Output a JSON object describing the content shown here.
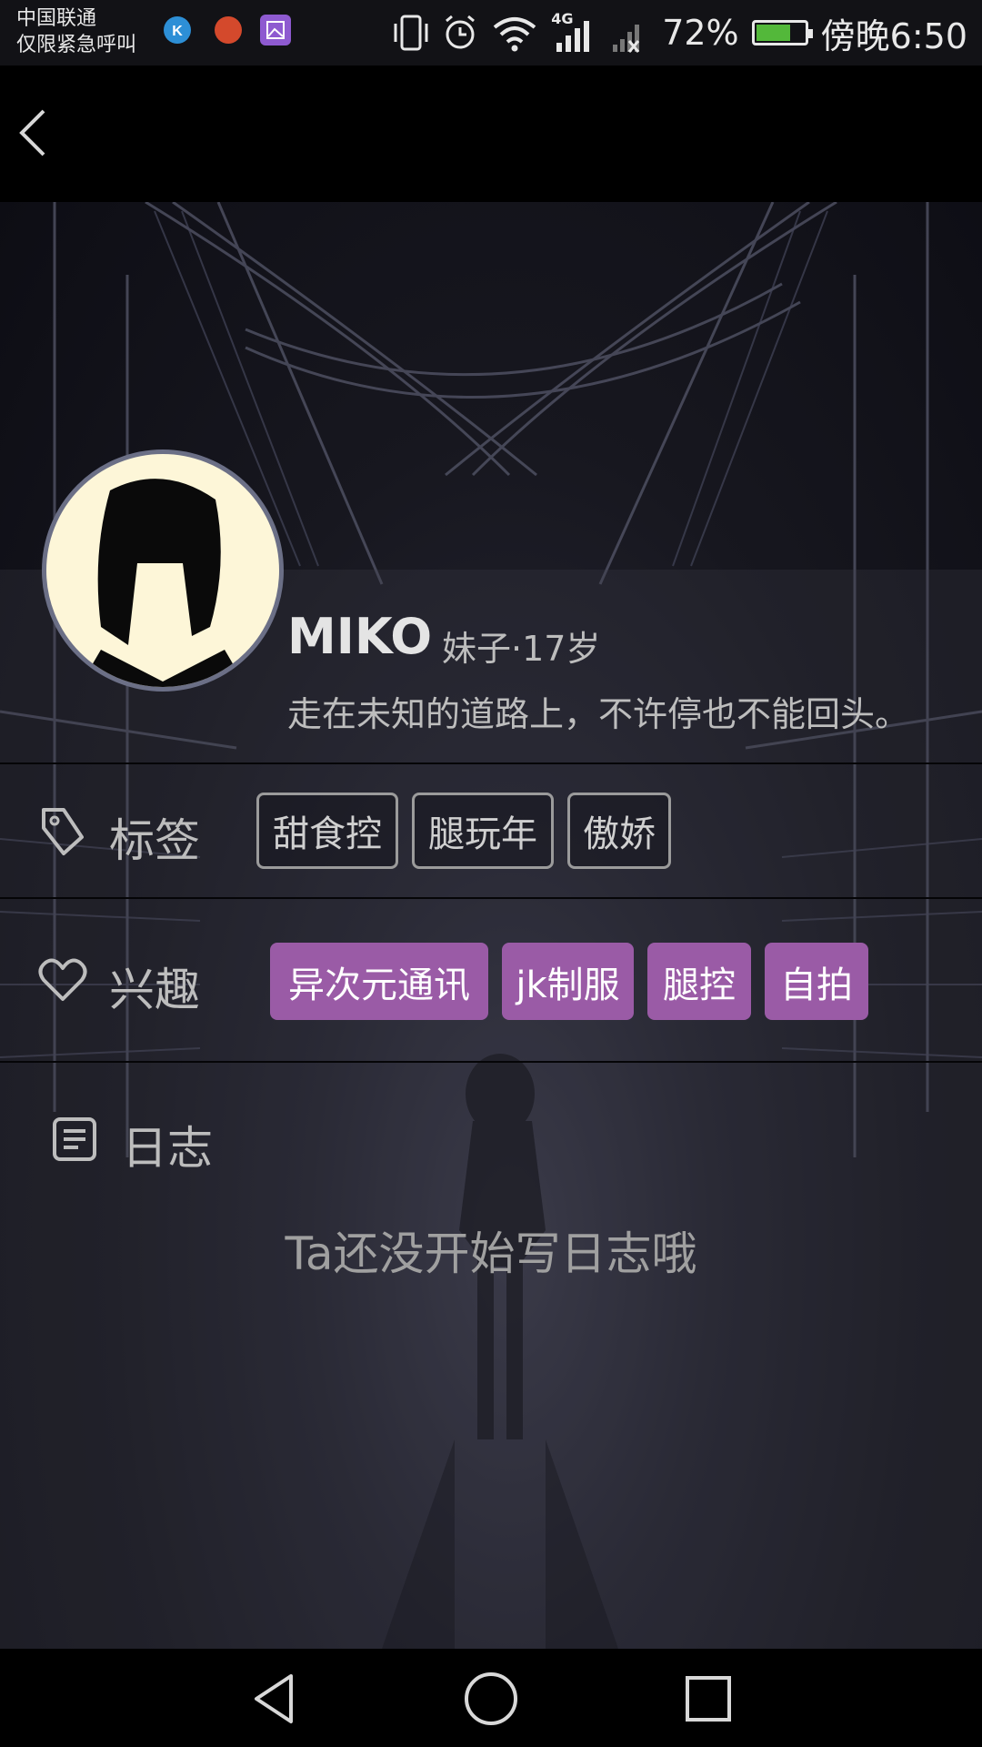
{
  "status_bar": {
    "carrier_line1": "中国联通",
    "carrier_line2": "仅限紧急呼叫",
    "network": "4G",
    "battery_percent": "72%",
    "battery_level": 0.72,
    "time": "傍晚6:50",
    "icons": [
      "kugou-icon",
      "weibo-icon",
      "gallery-icon",
      "vibrate-icon",
      "alarm-icon",
      "wifi-icon",
      "signal-icon",
      "no-signal-icon",
      "battery-icon"
    ]
  },
  "header": {
    "back_icon": "chevron-left-icon"
  },
  "profile": {
    "name": "MIKO",
    "meta": "妹子·17岁",
    "bio": "走在未知的道路上，不许停也不能回头。"
  },
  "tags": {
    "label": "标签",
    "icon": "tag-icon",
    "items": [
      "甜食控",
      "腿玩年",
      "傲娇"
    ]
  },
  "interests": {
    "label": "兴趣",
    "icon": "heart-icon",
    "items": [
      "异次元通讯",
      "jk制服",
      "腿控",
      "自拍"
    ]
  },
  "journal": {
    "label": "日志",
    "icon": "document-icon",
    "empty_message": "Ta还没开始写日志哦"
  },
  "colors": {
    "interest_tag": "#9a5ba6",
    "background": "#17171f",
    "text_secondary": "#bdbdbd"
  },
  "nav_bar": {
    "icons": [
      "nav-back-icon",
      "nav-home-icon",
      "nav-recents-icon"
    ]
  }
}
